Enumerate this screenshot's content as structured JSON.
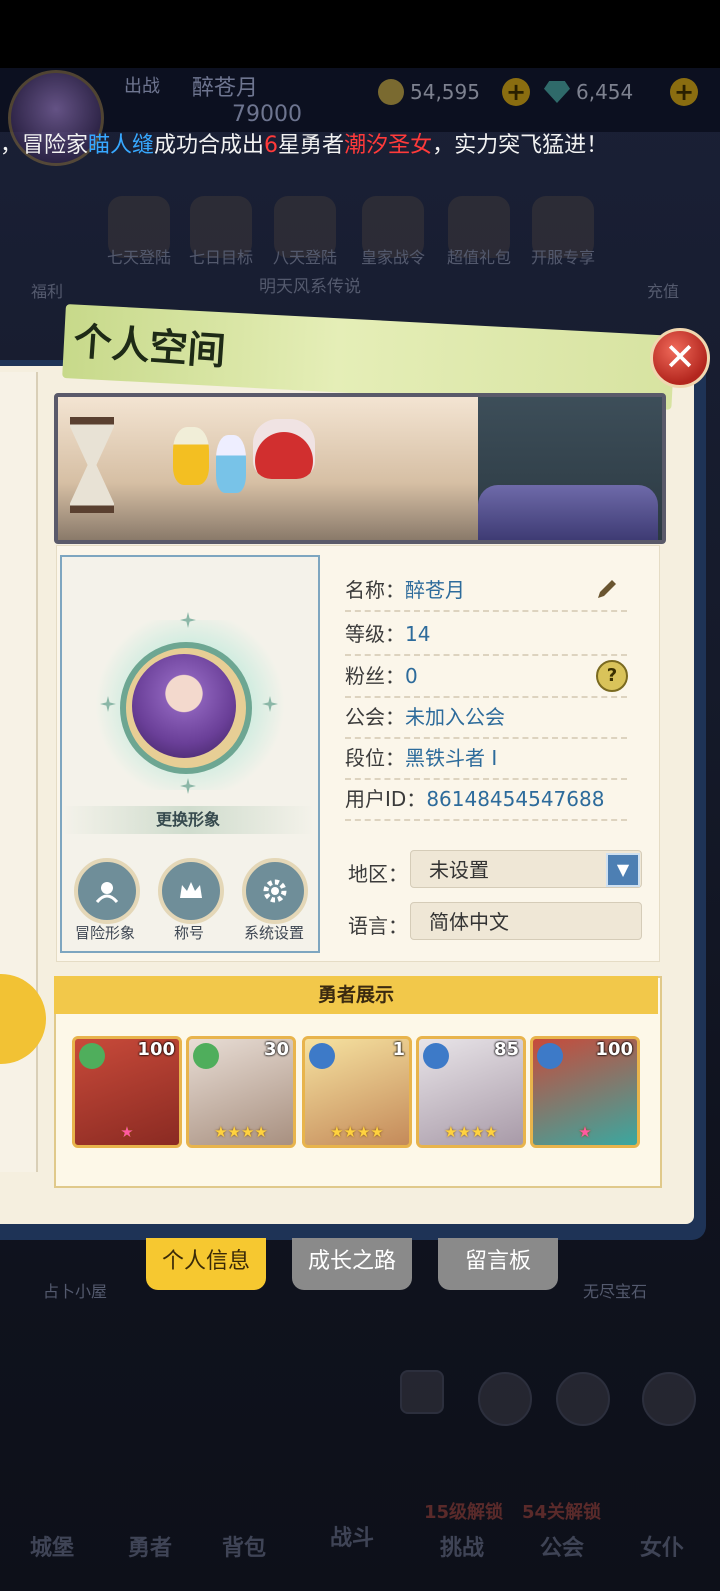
{
  "hud": {
    "player_name": "醉苍月",
    "power": "79000",
    "gold": "54,595",
    "gems": "6,454",
    "sub_label": "出战"
  },
  "ticker": {
    "part1": "，冒险家",
    "player": "瞄人缝",
    "part2": "成功合成出",
    "star": "6",
    "part3": "星勇者",
    "hero": "潮汐圣女",
    "part4": "，实力突飞猛进！"
  },
  "background_menu": {
    "items": [
      "七天登陆",
      "七日目标",
      "八天登陆",
      "皇家战令",
      "超值礼包",
      "开服专享"
    ],
    "left_label": "福利",
    "right_label": "充值",
    "subtitle": "明天风系传说",
    "under_labels": [
      "占卜小屋",
      "无尽宝石"
    ]
  },
  "bottom_nav": {
    "items": [
      "城堡",
      "勇者",
      "背包",
      "战斗",
      "挑战",
      "公会",
      "女仆"
    ],
    "locks": [
      "15级解锁",
      "54关解锁"
    ]
  },
  "panel": {
    "title": "个人空间",
    "close": "✕",
    "change_look": "更换形象",
    "buttons": [
      {
        "label": "冒险形象",
        "icon": "adventure-look-icon"
      },
      {
        "label": "称号",
        "icon": "crown-icon"
      },
      {
        "label": "系统设置",
        "icon": "gear-icon"
      }
    ],
    "info": {
      "name_label": "名称：",
      "name": "醉苍月",
      "level_label": "等级：",
      "level": "14",
      "fans_label": "粉丝：",
      "fans": "0",
      "guild_label": "公会：",
      "guild": "未加入公会",
      "rank_label": "段位：",
      "rank": "黑铁斗者 I",
      "uid_label": "用户ID：",
      "uid": "86148454547688",
      "region_label": "地区：",
      "region": "未设置",
      "lang_label": "语言：",
      "lang": "简体中文"
    },
    "heroes_title": "勇者展示",
    "heroes": [
      {
        "level": "100",
        "element": "wind",
        "stars": "★"
      },
      {
        "level": "30",
        "element": "wind",
        "stars": "★★★★"
      },
      {
        "level": "1",
        "element": "water",
        "stars": "★★★★"
      },
      {
        "level": "85",
        "element": "water",
        "stars": "★★★★"
      },
      {
        "level": "100",
        "element": "water",
        "stars": "★"
      }
    ],
    "tabs": [
      "个人信息",
      "成长之路",
      "留言板"
    ]
  },
  "colors": {
    "accent": "#f6c830",
    "panel_border": "#1e3356",
    "value_blue": "#2d6b9b"
  }
}
